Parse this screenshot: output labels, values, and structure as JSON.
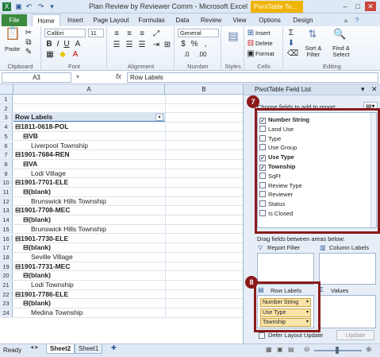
{
  "titlebar": {
    "title": "Plan Review by Reviewer Comm  -  Microsoft Excel",
    "contextual_tab": "PivotTable To...",
    "controls": [
      "–",
      "□",
      "✕"
    ]
  },
  "tabs": [
    "File",
    "Home",
    "Insert",
    "Page Layout",
    "Formulas",
    "Data",
    "Review",
    "View",
    "Options",
    "Design"
  ],
  "ribbon": {
    "clipboard": {
      "paste": "Paste",
      "label": "Clipboard"
    },
    "font": {
      "name": "Calibri",
      "size": "11",
      "bold": "B",
      "italic": "I",
      "underline": "U",
      "label": "Font"
    },
    "alignment": {
      "label": "Alignment"
    },
    "number": {
      "format": "General",
      "currency": "$",
      "percent": "%",
      "comma": ",",
      "label": "Number"
    },
    "styles": {
      "label": "Styles"
    },
    "cells": {
      "insert": "Insert",
      "delete": "Delete",
      "format": "Format",
      "label": "Cells"
    },
    "editing": {
      "sort": "Sort & Filter",
      "find": "Find & Select",
      "label": "Editing"
    }
  },
  "formula_bar": {
    "name_box": "A3",
    "fx": "fx",
    "value": "Row Labels"
  },
  "columns": [
    "A",
    "B"
  ],
  "rows": [
    {
      "n": "1",
      "text": "",
      "indent": 0,
      "bold": false
    },
    {
      "n": "2",
      "text": "",
      "indent": 0,
      "bold": false
    },
    {
      "n": "3",
      "text": "Row Labels",
      "indent": 0,
      "bold": true,
      "header": true
    },
    {
      "n": "4",
      "text": "⊟1811-0618-POL",
      "indent": 0,
      "bold": true
    },
    {
      "n": "5",
      "text": "⊟VB",
      "indent": 1,
      "bold": true
    },
    {
      "n": "6",
      "text": "Liverpool Township",
      "indent": 2,
      "bold": false
    },
    {
      "n": "7",
      "text": "⊟1901-7684-REN",
      "indent": 0,
      "bold": true
    },
    {
      "n": "8",
      "text": "⊟VA",
      "indent": 1,
      "bold": true
    },
    {
      "n": "9",
      "text": "Lodi Village",
      "indent": 2,
      "bold": false
    },
    {
      "n": "10",
      "text": "⊟1901-7701-ELE",
      "indent": 0,
      "bold": true
    },
    {
      "n": "11",
      "text": "⊟(blank)",
      "indent": 1,
      "bold": true
    },
    {
      "n": "12",
      "text": "Brunswick Hills Township",
      "indent": 2,
      "bold": false
    },
    {
      "n": "13",
      "text": "⊟1901-7708-MEC",
      "indent": 0,
      "bold": true
    },
    {
      "n": "14",
      "text": "⊟(blank)",
      "indent": 1,
      "bold": true
    },
    {
      "n": "15",
      "text": "Brunswick Hills Township",
      "indent": 2,
      "bold": false
    },
    {
      "n": "16",
      "text": "⊟1901-7730-ELE",
      "indent": 0,
      "bold": true
    },
    {
      "n": "17",
      "text": "⊟(blank)",
      "indent": 1,
      "bold": true
    },
    {
      "n": "18",
      "text": "Seville Village",
      "indent": 2,
      "bold": false
    },
    {
      "n": "19",
      "text": "⊟1901-7731-MEC",
      "indent": 0,
      "bold": true
    },
    {
      "n": "20",
      "text": "⊟(blank)",
      "indent": 1,
      "bold": true
    },
    {
      "n": "21",
      "text": "Lodi Township",
      "indent": 2,
      "bold": false
    },
    {
      "n": "22",
      "text": "⊟1901-7786-ELE",
      "indent": 0,
      "bold": true
    },
    {
      "n": "23",
      "text": "⊟(blank)",
      "indent": 1,
      "bold": true
    },
    {
      "n": "24",
      "text": "Medina Township",
      "indent": 2,
      "bold": false
    }
  ],
  "pane": {
    "title": "PivotTable Field List",
    "choose_label": "Choose fields to add to report:",
    "fields": [
      {
        "label": "Number String",
        "checked": true
      },
      {
        "label": "Land Use",
        "checked": false
      },
      {
        "label": "Type",
        "checked": false
      },
      {
        "label": "Use Group",
        "checked": false
      },
      {
        "label": "Use Type",
        "checked": true
      },
      {
        "label": "Township",
        "checked": true
      },
      {
        "label": "SqFt",
        "checked": false
      },
      {
        "label": "Review Type",
        "checked": false
      },
      {
        "label": "Reviewer",
        "checked": false
      },
      {
        "label": "Status",
        "checked": false
      },
      {
        "label": "Is Closed",
        "checked": false
      }
    ],
    "drag_label": "Drag fields between areas below:",
    "report_filter": "Report Filter",
    "column_labels": "Column Labels",
    "row_labels": "Row Labels",
    "values": "Values",
    "row_chips": [
      "Number String",
      "Use Type",
      "Township"
    ],
    "defer": "Defer Layout Update",
    "update": "Update",
    "badge1": "7",
    "badge2": "8"
  },
  "status": {
    "ready": "Ready",
    "sheets": [
      "Sheet2",
      "Sheet1"
    ]
  }
}
